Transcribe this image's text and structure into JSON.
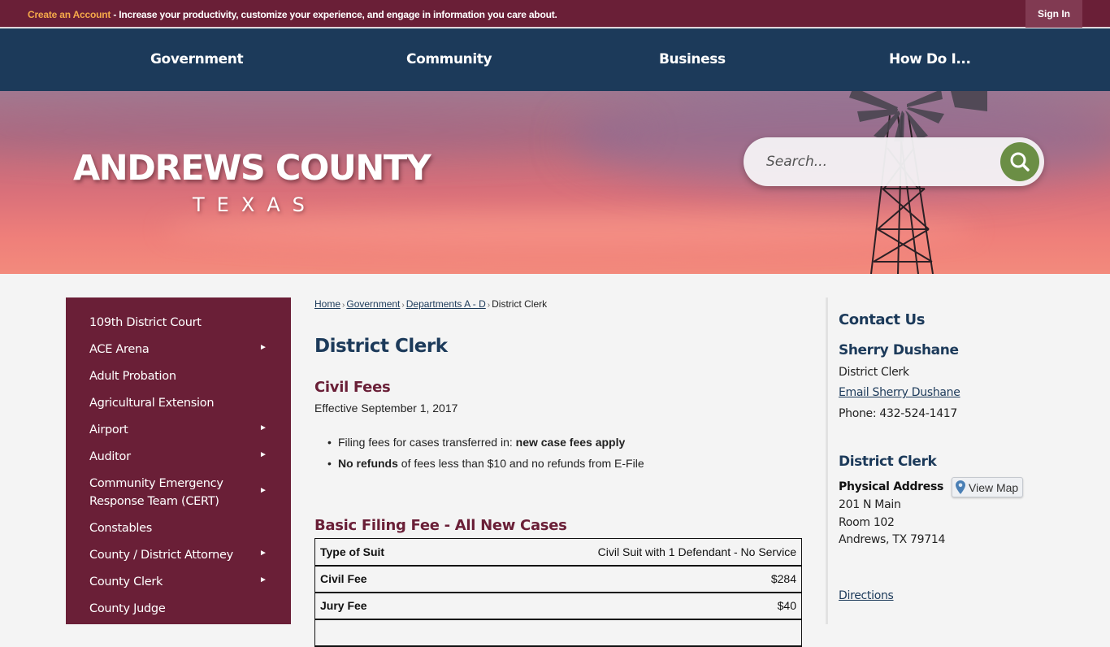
{
  "topbar": {
    "create_account_label": "Create an Account",
    "message": " - Increase your productivity, customize your experience, and engage in information you care about.",
    "sign_in_label": "Sign In",
    "accent_color": "#f5a94a"
  },
  "nav": {
    "items": [
      {
        "label": "Government"
      },
      {
        "label": "Community"
      },
      {
        "label": "Business"
      },
      {
        "label": "How Do I..."
      }
    ]
  },
  "banner": {
    "title": "ANDREWS COUNTY",
    "subtitle": "TEXAS",
    "search_placeholder": "Search...",
    "search_icon": "search-icon"
  },
  "sidebar": {
    "items": [
      {
        "label": "109th District Court",
        "has_submenu": false
      },
      {
        "label": "ACE Arena",
        "has_submenu": true
      },
      {
        "label": "Adult Probation",
        "has_submenu": false
      },
      {
        "label": "Agricultural Extension",
        "has_submenu": false
      },
      {
        "label": "Airport",
        "has_submenu": true
      },
      {
        "label": "Auditor",
        "has_submenu": true
      },
      {
        "label": "Community Emergency Response Team (CERT)",
        "has_submenu": true
      },
      {
        "label": "Constables",
        "has_submenu": false
      },
      {
        "label": "County / District Attorney",
        "has_submenu": true
      },
      {
        "label": "County Clerk",
        "has_submenu": true
      },
      {
        "label": "County Judge",
        "has_submenu": false
      }
    ],
    "arrow_glyph": "►"
  },
  "breadcrumb": {
    "items": [
      "Home",
      "Government",
      "Departments A - D"
    ],
    "current": "District Clerk",
    "separator": "›"
  },
  "main": {
    "title": "District Clerk",
    "civil_heading": "Civil Fees",
    "effective": "Effective September 1, 2017",
    "bullets": [
      {
        "pre": "Filing fees for cases transferred in: ",
        "bold": "new case fees apply",
        "post": ""
      },
      {
        "pre": "",
        "bold": "No refunds",
        "post": " of fees less than $10 and no refunds from E-File"
      }
    ],
    "basic_heading": "Basic Filing Fee - All New Cases",
    "fee_table": [
      {
        "label": "Type of Suit",
        "value": "Civil Suit with 1 Defendant - No Service"
      },
      {
        "label": "Civil Fee",
        "value": "$284"
      },
      {
        "label": "Jury Fee",
        "value": "$40"
      }
    ]
  },
  "contact": {
    "heading": "Contact Us",
    "name": "Sherry Dushane",
    "role": "District Clerk",
    "email_label": "Email Sherry Dushane",
    "phone": "Phone: 432-524-1417",
    "dept_heading": "District Clerk",
    "address_label": "Physical Address",
    "view_map_label": "View Map",
    "address_lines": [
      "201 N Main",
      "Room 102",
      "Andrews, TX 79714"
    ],
    "directions_label": "Directions"
  },
  "colors": {
    "maroon": "#6a1f37",
    "navy": "#1c3a5a",
    "green": "#6b8e45",
    "page_bg": "#f4f4f4"
  }
}
